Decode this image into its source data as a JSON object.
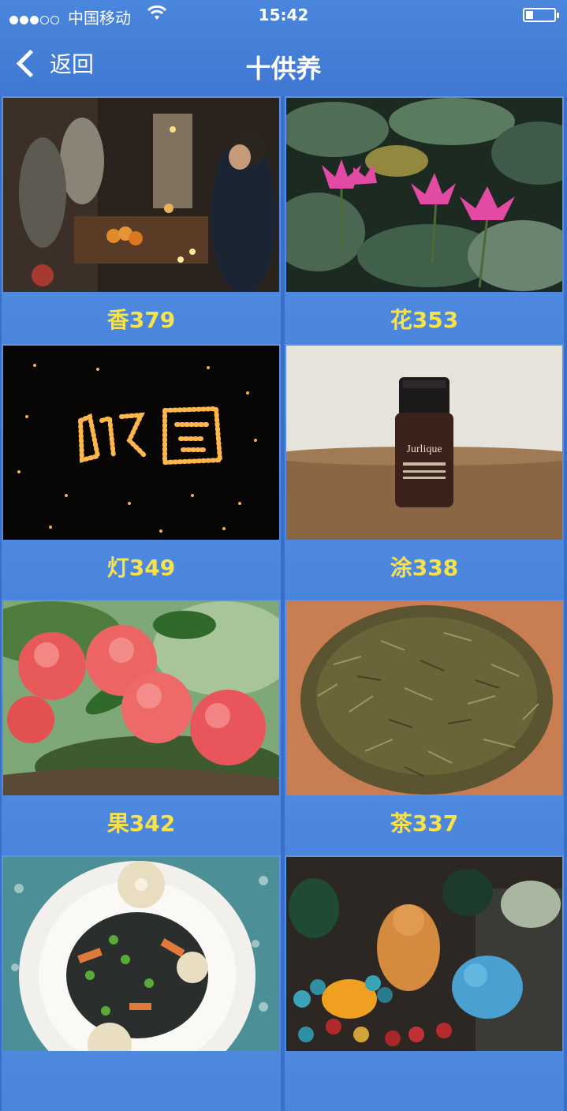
{
  "status_bar": {
    "carrier": "中国移动",
    "time": "15:42",
    "signal_strength": 3,
    "battery_level": 0.25
  },
  "nav": {
    "back_label": "返回",
    "title": "十供养"
  },
  "items": [
    {
      "label": "香379",
      "icon": "incense-altar-photo"
    },
    {
      "label": "花353",
      "icon": "lotus-photo"
    },
    {
      "label": "灯349",
      "icon": "candle-lights-photo"
    },
    {
      "label": "涂338",
      "icon": "oil-bottle-photo"
    },
    {
      "label": "果342",
      "icon": "peaches-photo"
    },
    {
      "label": "茶337",
      "icon": "tea-leaves-photo"
    },
    {
      "label": "",
      "icon": "vegetable-dish-photo"
    },
    {
      "label": "",
      "icon": "jade-ornaments-photo"
    }
  ],
  "decor": {
    "thumb_text": "Jurlique"
  }
}
